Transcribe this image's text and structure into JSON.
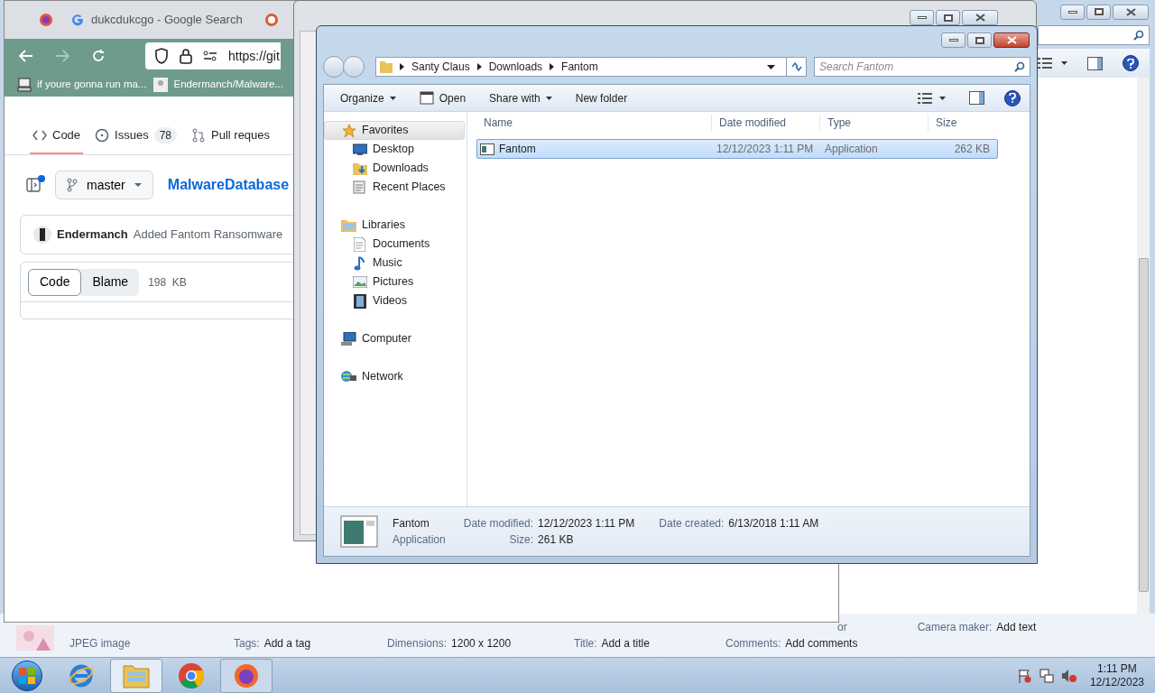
{
  "back_window": {
    "type": "JPEG image",
    "details": [
      {
        "label": "Tags:",
        "value": "Add a tag"
      },
      {
        "label": "Dimensions:",
        "value": "1200 x 1200"
      },
      {
        "label": "Title:",
        "value": "Add a title"
      },
      {
        "label": "Comments:",
        "value": "Add comments"
      }
    ],
    "top_details": [
      {
        "label": "or"
      },
      {
        "label": "Camera maker:",
        "value": "Add text"
      }
    ]
  },
  "browser": {
    "tabs": [
      {
        "kind": "firefox",
        "selected": false
      },
      {
        "kind": "google",
        "title": "dukcdukcgo - Google Search",
        "selected": false
      },
      {
        "kind": "duckduckgo",
        "selected": false
      }
    ],
    "url": "https://git",
    "bookmarks": [
      {
        "kind": "computer",
        "label": "if youre gonna run ma..."
      },
      {
        "kind": "avatar",
        "label": "Endermanch/Malware..."
      }
    ],
    "repo_nav": [
      {
        "kind": "code",
        "label": "Code",
        "selected": true
      },
      {
        "kind": "issues",
        "label": "Issues",
        "count": "78",
        "selected": false
      },
      {
        "kind": "pulls",
        "label": "Pull reques",
        "selected": false
      }
    ],
    "branch": "master",
    "repo_link": "MalwareDatabase",
    "commit": {
      "author": "Endermanch",
      "message": "Added Fantom Ransomware"
    },
    "file_tabs": [
      {
        "label": "Code",
        "selected": true
      },
      {
        "label": "Blame",
        "selected": false
      }
    ],
    "file_size": "198  KB"
  },
  "explorer": {
    "breadcrumbs": [
      "Santy Claus",
      "Downloads",
      "Fantom"
    ],
    "search_placeholder": "Search Fantom",
    "toolbar": [
      {
        "kind": "menu",
        "label": "Organize"
      },
      {
        "kind": "open",
        "label": "Open"
      },
      {
        "kind": "menu",
        "label": "Share with"
      },
      {
        "kind": "plain",
        "label": "New folder"
      }
    ],
    "nav": [
      {
        "kind": "favorites",
        "label": "Favorites",
        "selected": true,
        "children": [
          {
            "kind": "desktop",
            "label": "Desktop",
            "selected": false
          },
          {
            "kind": "downloads",
            "label": "Downloads",
            "selected": false
          },
          {
            "kind": "recent",
            "label": "Recent Places",
            "selected": false
          }
        ]
      },
      {
        "kind": "libraries",
        "label": "Libraries",
        "selected": false,
        "children": [
          {
            "kind": "documents",
            "label": "Documents",
            "selected": false
          },
          {
            "kind": "music",
            "label": "Music",
            "selected": false
          },
          {
            "kind": "pictures",
            "label": "Pictures",
            "selected": false
          },
          {
            "kind": "videos",
            "label": "Videos",
            "selected": false
          }
        ]
      },
      {
        "kind": "computer",
        "label": "Computer",
        "selected": false
      },
      {
        "kind": "network",
        "label": "Network",
        "selected": false
      }
    ],
    "columns": [
      "Name",
      "Date modified",
      "Type",
      "Size"
    ],
    "files": [
      {
        "name": "Fantom",
        "date": "12/12/2023 1:11 PM",
        "type": "Application",
        "size": "262 KB",
        "selected": true
      }
    ],
    "details": {
      "name": "Fantom",
      "type": "Application",
      "fields": [
        {
          "label": "Date modified:",
          "value": "12/12/2023 1:11 PM"
        },
        {
          "label": "Size:",
          "value": "261 KB"
        },
        {
          "label": "Date created:",
          "value": "6/13/2018 1:11 AM"
        }
      ]
    }
  },
  "taskbar": {
    "apps": [
      {
        "kind": "ie",
        "open": false,
        "selected": false
      },
      {
        "kind": "explorer",
        "open": true,
        "selected": true
      },
      {
        "kind": "chrome",
        "open": false,
        "selected": false
      },
      {
        "kind": "firefox",
        "open": true,
        "selected": false
      }
    ],
    "time": "1:11 PM",
    "date": "12/12/2023"
  }
}
